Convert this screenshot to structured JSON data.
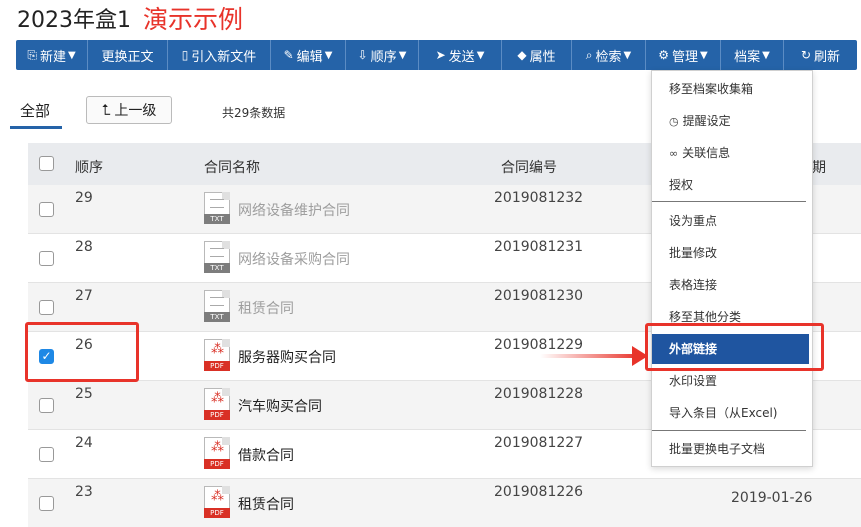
{
  "header": {
    "box_title": "2023年盒1",
    "demo_label": "演示示例"
  },
  "toolbar": [
    {
      "label": "新建",
      "icon": "new-doc-icon",
      "glyph": "⎘",
      "dropdown": true,
      "width": 72
    },
    {
      "label": "更换正文",
      "icon": "",
      "glyph": "",
      "dropdown": false,
      "width": 80
    },
    {
      "label": "引入新文件",
      "icon": "import-file-icon",
      "glyph": "▯",
      "dropdown": false,
      "width": 103
    },
    {
      "label": "编辑",
      "icon": "edit-icon",
      "glyph": "✎",
      "dropdown": true,
      "width": 75
    },
    {
      "label": "顺序",
      "icon": "order-icon",
      "glyph": "⇩",
      "dropdown": true,
      "width": 73
    },
    {
      "label": "发送",
      "icon": "send-icon",
      "glyph": "➤",
      "dropdown": true,
      "width": 83
    },
    {
      "label": "属性",
      "icon": "tag-icon",
      "glyph": "◆",
      "dropdown": false,
      "width": 70
    },
    {
      "label": "检索",
      "icon": "search-icon",
      "glyph": "⌕",
      "dropdown": true,
      "width": 74
    },
    {
      "label": "管理",
      "icon": "gear-icon",
      "glyph": "⚙",
      "dropdown": true,
      "width": 75
    },
    {
      "label": "档案",
      "icon": "",
      "glyph": "",
      "dropdown": true,
      "width": 63
    },
    {
      "label": "刷新",
      "icon": "refresh-icon",
      "glyph": "↻",
      "dropdown": false,
      "width": 73
    }
  ],
  "tabs": {
    "all": "全部",
    "up_level": "上一级",
    "count_text": "共29条数据"
  },
  "table": {
    "headers": {
      "seq": "顺序",
      "name": "合同名称",
      "number": "合同编号",
      "date_partial": "期"
    },
    "rows": [
      {
        "seq": "29",
        "type": "TXT",
        "name": "网络设备维护合同",
        "number": "2019081232",
        "date": "",
        "checked": false
      },
      {
        "seq": "28",
        "type": "TXT",
        "name": "网络设备采购合同",
        "number": "2019081231",
        "date": "",
        "checked": false
      },
      {
        "seq": "27",
        "type": "TXT",
        "name": "租赁合同",
        "number": "2019081230",
        "date": "",
        "checked": false
      },
      {
        "seq": "26",
        "type": "PDF",
        "name": "服务器购买合同",
        "number": "2019081229",
        "date": "",
        "checked": true
      },
      {
        "seq": "25",
        "type": "PDF",
        "name": "汽车购买合同",
        "number": "2019081228",
        "date": "",
        "checked": false
      },
      {
        "seq": "24",
        "type": "PDF",
        "name": "借款合同",
        "number": "2019081227",
        "date": "",
        "checked": false
      },
      {
        "seq": "23",
        "type": "PDF",
        "name": "租赁合同",
        "number": "2019081226",
        "date": "2019-01-26",
        "checked": false
      }
    ]
  },
  "manage_menu": [
    {
      "label": "移至档案收集箱",
      "icon": "",
      "glyph": ""
    },
    {
      "label": "提醒设定",
      "icon": "clock-icon",
      "glyph": "◷"
    },
    {
      "label": "关联信息",
      "icon": "link-icon",
      "glyph": "∞"
    },
    {
      "label": "授权",
      "icon": "",
      "glyph": ""
    },
    {
      "label": "设为重点",
      "icon": "",
      "glyph": ""
    },
    {
      "label": "批量修改",
      "icon": "",
      "glyph": ""
    },
    {
      "label": "表格连接",
      "icon": "",
      "glyph": ""
    },
    {
      "label": "移至其他分类",
      "icon": "",
      "glyph": ""
    },
    {
      "label": "外部链接",
      "icon": "",
      "glyph": ""
    },
    {
      "label": "水印设置",
      "icon": "",
      "glyph": ""
    },
    {
      "label": "导入条目（从Excel)",
      "icon": "",
      "glyph": ""
    },
    {
      "label": "批量更换电子文档",
      "icon": "",
      "glyph": ""
    }
  ],
  "colors": {
    "toolbar_bg": "#2563a8",
    "menu_active": "#1f55a0",
    "annotation_red": "#e8332a",
    "checkbox_blue": "#1e88e5"
  }
}
